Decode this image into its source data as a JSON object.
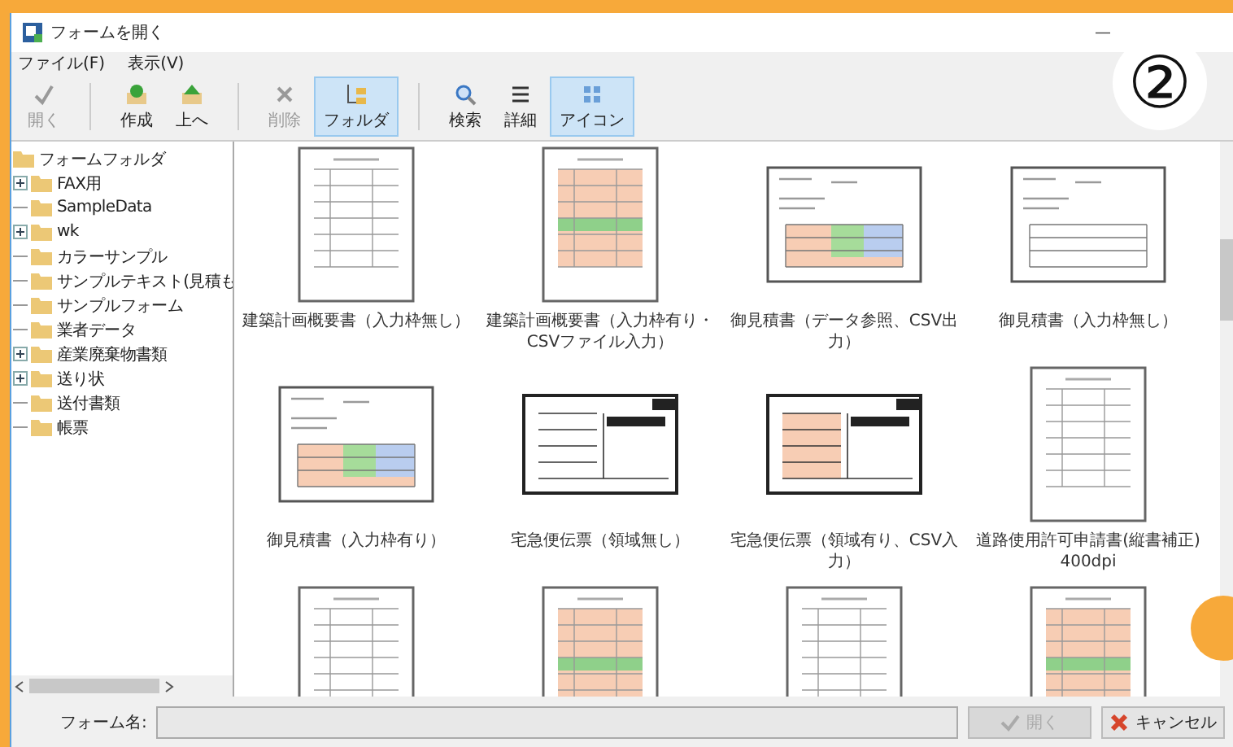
{
  "window": {
    "title": "フォームを開く",
    "minimize": "—"
  },
  "badge": "②",
  "menu": [
    "ファイル(F)",
    "表示(V)"
  ],
  "toolbar": [
    {
      "kind": "open",
      "label": "開く",
      "disabled": true,
      "selected": false
    },
    {
      "kind": "create",
      "label": "作成",
      "disabled": false,
      "selected": false
    },
    {
      "kind": "up",
      "label": "上へ",
      "disabled": false,
      "selected": false
    },
    {
      "kind": "delete",
      "label": "削除",
      "disabled": true,
      "selected": false
    },
    {
      "kind": "folder",
      "label": "フォルダ",
      "disabled": false,
      "selected": true
    },
    {
      "kind": "search",
      "label": "検索",
      "disabled": false,
      "selected": false
    },
    {
      "kind": "details",
      "label": "詳細",
      "disabled": false,
      "selected": false
    },
    {
      "kind": "icons",
      "label": "アイコン",
      "disabled": false,
      "selected": true
    }
  ],
  "tree": {
    "label": "フォームフォルダ",
    "children": [
      {
        "label": "FAX用",
        "kind": "collapsed"
      },
      {
        "label": "SampleData",
        "kind": "leaf"
      },
      {
        "label": "wk",
        "kind": "collapsed"
      },
      {
        "label": "カラーサンプル",
        "kind": "leaf"
      },
      {
        "label": "サンプルテキスト(見積も",
        "kind": "leaf"
      },
      {
        "label": "サンプルフォーム",
        "kind": "leaf"
      },
      {
        "label": "業者データ",
        "kind": "leaf"
      },
      {
        "label": "産業廃棄物書類",
        "kind": "collapsed"
      },
      {
        "label": "送り状",
        "kind": "collapsed"
      },
      {
        "label": "送付書類",
        "kind": "leaf"
      },
      {
        "label": "帳票",
        "kind": "leaf"
      }
    ]
  },
  "forms": [
    {
      "kind": "portrait",
      "label": "建築計画概要書（入力枠無し）"
    },
    {
      "kind": "portrait-color",
      "label": "建築計画概要書（入力枠有り・CSVファイル入力）"
    },
    {
      "kind": "landscape-color",
      "label": "御見積書（データ参照、CSV出力）"
    },
    {
      "kind": "landscape",
      "label": "御見積書（入力枠無し）"
    },
    {
      "kind": "landscape-color",
      "label": "御見積書（入力枠有り）"
    },
    {
      "kind": "slip",
      "label": "宅急便伝票（領域無し）"
    },
    {
      "kind": "slip-color",
      "label": "宅急便伝票（領域有り、CSV入力）"
    },
    {
      "kind": "portrait",
      "label": "道路使用許可申請書(縦書補正)\n400dpi"
    },
    {
      "kind": "portrait"
    },
    {
      "kind": "portrait-color"
    },
    {
      "kind": "portrait"
    },
    {
      "kind": "portrait-color"
    }
  ],
  "footer": {
    "label": "フォーム名:",
    "ok": {
      "label": "開く",
      "disabled": true
    },
    "cancel": "キャンセル"
  }
}
